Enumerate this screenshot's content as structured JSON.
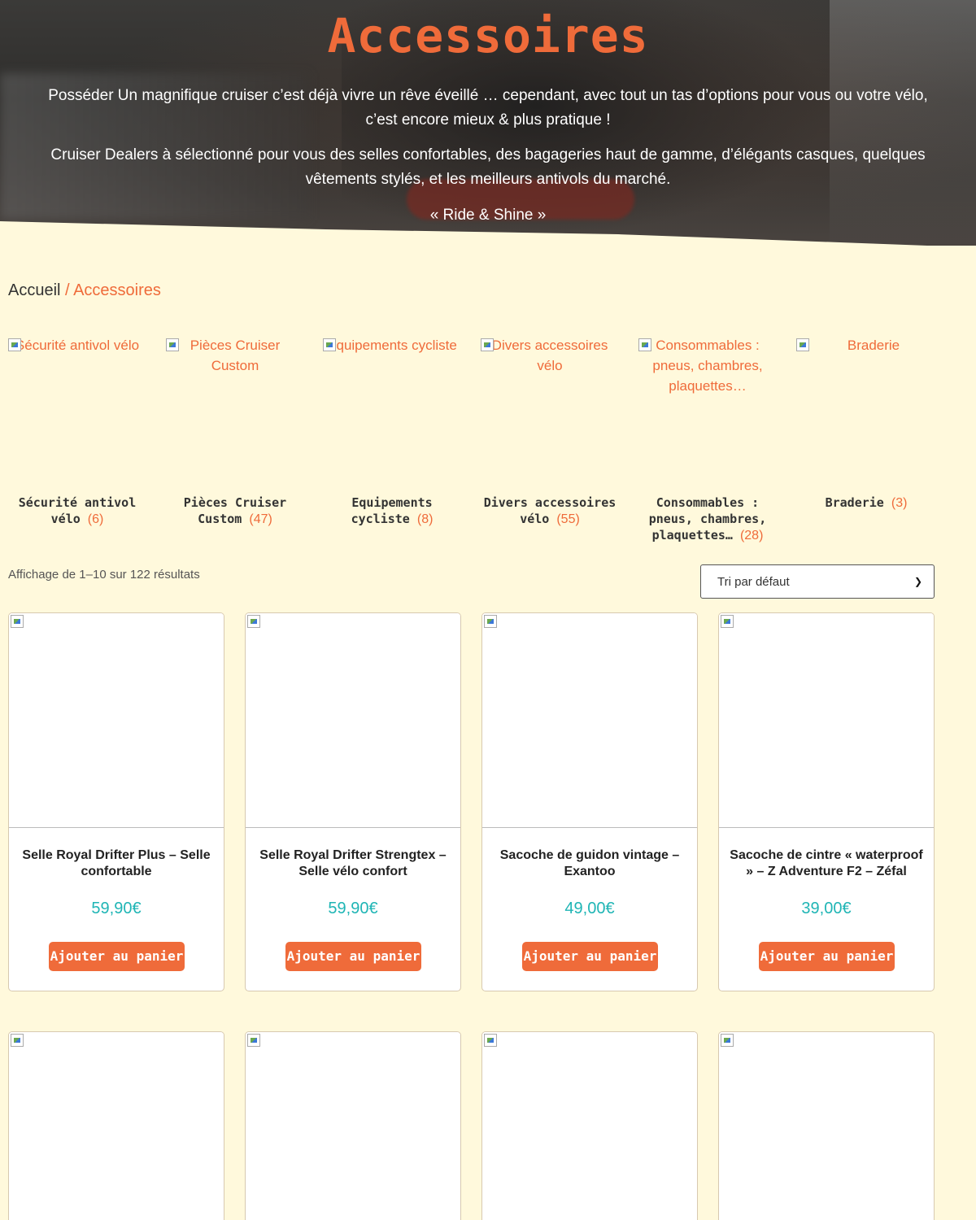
{
  "hero": {
    "title": "Accessoires",
    "paragraph1": "Posséder Un magnifique cruiser c’est déjà vivre un rêve éveillé … cependant, avec tout un tas d’options pour vous ou votre vélo, c’est encore mieux & plus pratique !",
    "paragraph2": "Cruiser Dealers à sélectionné pour vous des selles confortables, des bagageries haut de gamme, d’élégants casques, quelques vêtements stylés, et les meilleurs antivols du marché.",
    "tagline": "« Ride & Shine »"
  },
  "breadcrumb": {
    "home": "Accueil",
    "separator": " / ",
    "current": "Accessoires"
  },
  "categories": [
    {
      "alt": "Sécurité antivol vélo",
      "name": "Sécurité antivol vélo",
      "count": "(6)"
    },
    {
      "alt": "Pièces Cruiser Custom",
      "name": "Pièces Cruiser Custom",
      "count": "(47)"
    },
    {
      "alt": "Equipements cycliste",
      "name": "Equipements cycliste",
      "count": "(8)"
    },
    {
      "alt": "Divers accessoires vélo",
      "name": "Divers accessoires vélo",
      "count": "(55)"
    },
    {
      "alt": "Consommables : pneus, chambres, plaquettes…",
      "name": "Consommables : pneus, chambres, plaquettes…",
      "count": "(28)"
    },
    {
      "alt": "Braderie",
      "name": "Braderie",
      "count": "(3)"
    }
  ],
  "results_text": "Affichage de 1–10 sur 122 résultats",
  "sort": {
    "selected": "Tri par défaut"
  },
  "products": [
    {
      "title": "Selle Royal Drifter Plus – Selle confortable",
      "price": "59,90€",
      "button": "Ajouter au panier"
    },
    {
      "title": "Selle Royal Drifter Strengtex – Selle vélo confort",
      "price": "59,90€",
      "button": "Ajouter au panier"
    },
    {
      "title": "Sacoche de guidon vintage – Exantoo",
      "price": "49,00€",
      "button": "Ajouter au panier"
    },
    {
      "title": "Sacoche de cintre « waterproof » – Z Adventure F2 – Zéfal",
      "price": "39,00€",
      "button": "Ajouter au panier"
    }
  ],
  "icons": {
    "broken_image": "broken-image-icon",
    "sort_chevron": "chevron-down-icon"
  },
  "colors": {
    "accent": "#ef6b3a",
    "price": "#1fb5b5",
    "background": "#fff9dc"
  }
}
